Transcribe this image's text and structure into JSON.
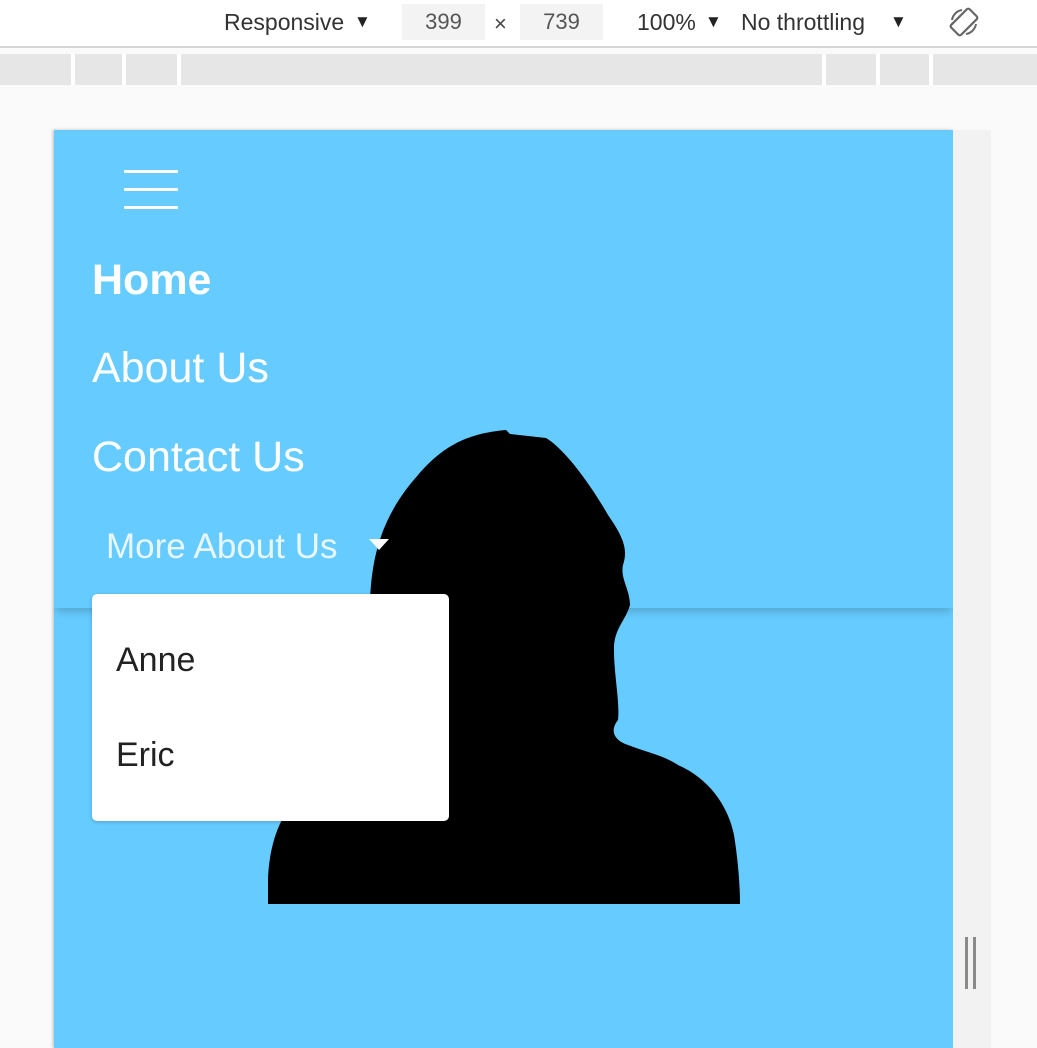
{
  "devtools": {
    "device_mode": "Responsive",
    "width": "399",
    "times": "×",
    "height": "739",
    "zoom": "100%",
    "throttling": "No throttling",
    "dropdown_arrow": "▼",
    "rotate_icon": "rotate-device-icon"
  },
  "page": {
    "background_color": "#66ccff",
    "menu_icon": "hamburger-menu-icon",
    "nav": {
      "home": "Home",
      "about": "About Us",
      "contact": "Contact Us",
      "more": "More About Us"
    },
    "dropdown_items": [
      "Anne",
      "Eric"
    ],
    "image_icon": "person-silhouette"
  }
}
